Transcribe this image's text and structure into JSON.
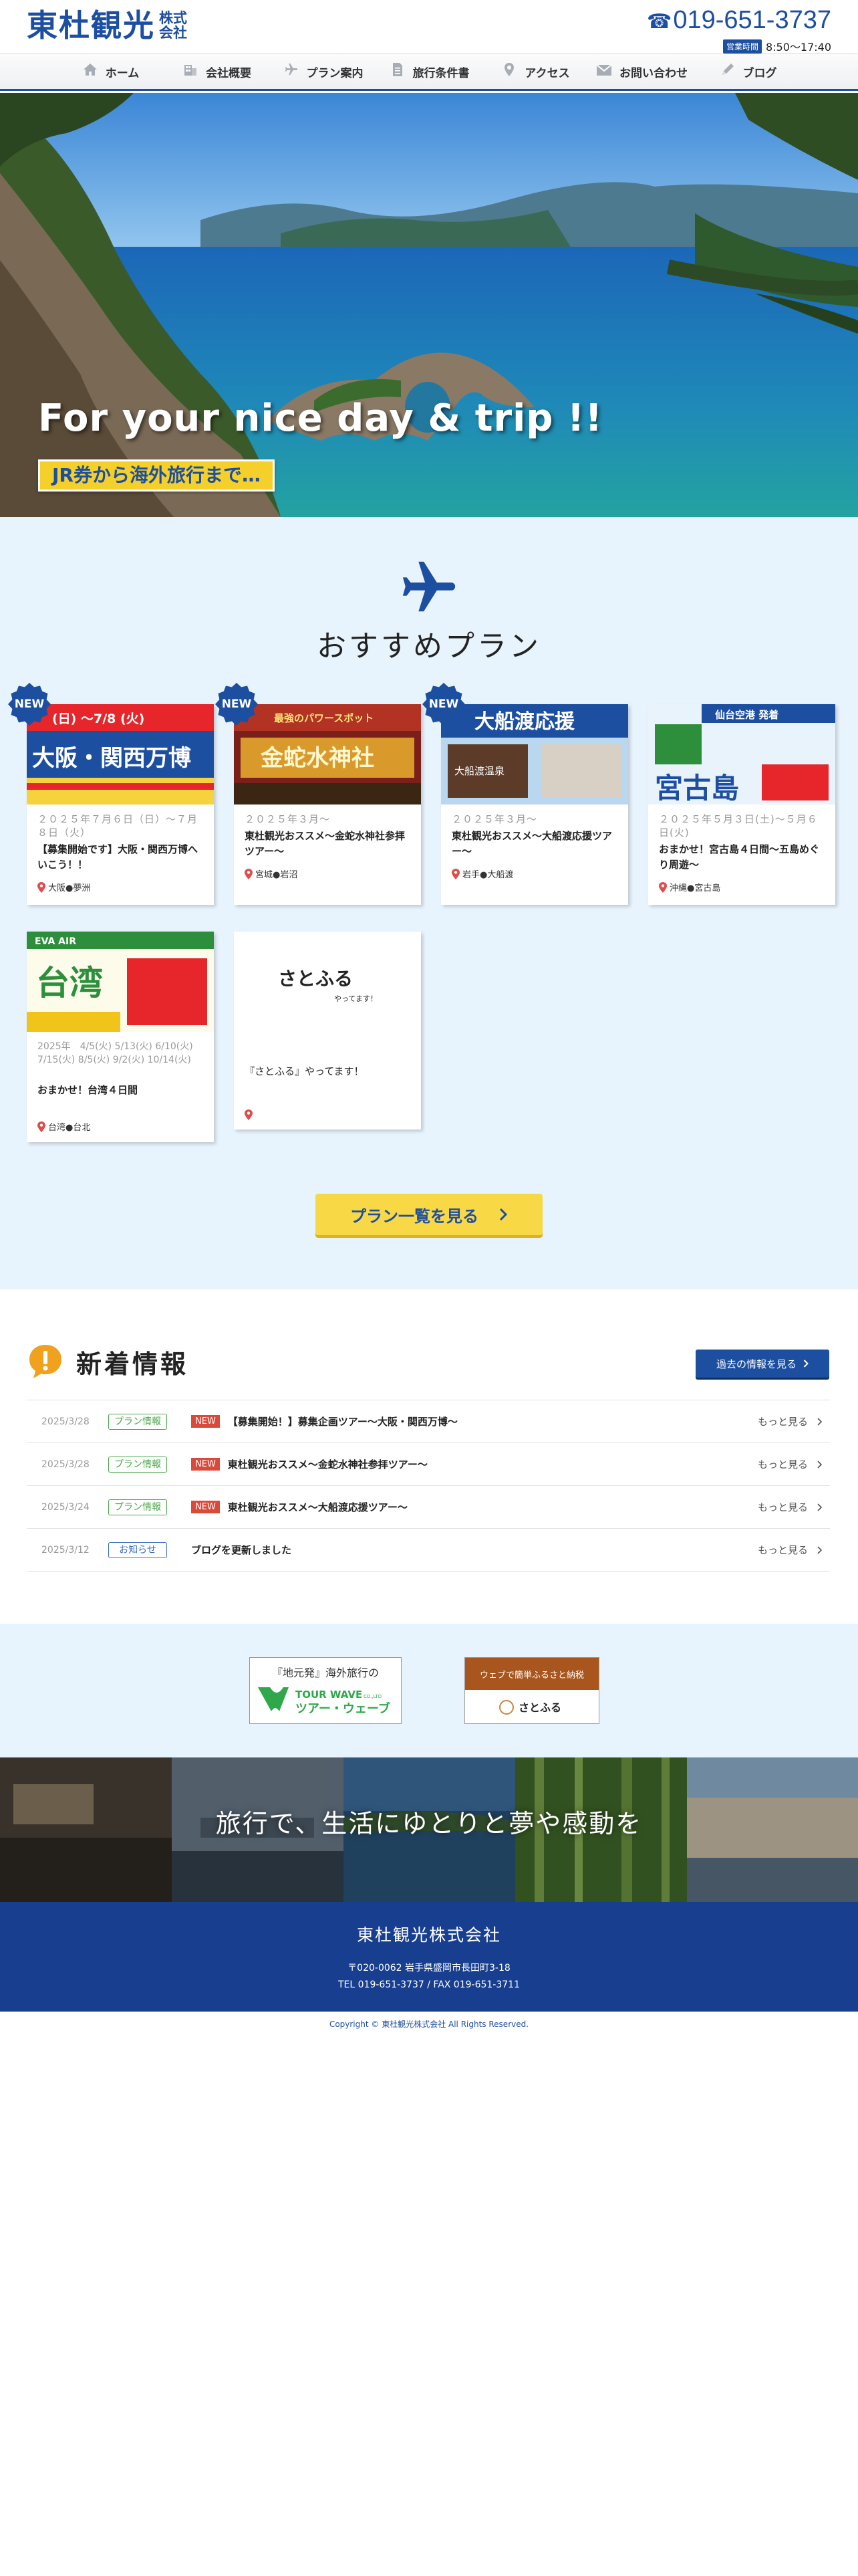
{
  "header": {
    "logo_main": "東杜観光",
    "logo_sub": "株式会社",
    "phone": "019-651-3737",
    "hours_label": "営業時間",
    "hours": "8:50～17:40"
  },
  "nav": [
    {
      "label": "ホーム",
      "icon": "home-icon"
    },
    {
      "label": "会社概要",
      "icon": "building-icon"
    },
    {
      "label": "プラン案内",
      "icon": "plane-icon"
    },
    {
      "label": "旅行条件書",
      "icon": "document-icon"
    },
    {
      "label": "アクセス",
      "icon": "map-pin-icon"
    },
    {
      "label": "お問い合わせ",
      "icon": "mail-icon"
    },
    {
      "label": "ブログ",
      "icon": "pencil-icon"
    }
  ],
  "hero": {
    "title": "For your nice day & trip !!",
    "badge": "JR券から海外旅行まで…"
  },
  "plans": {
    "title": "おすすめプラン",
    "new_label": "NEW",
    "items": [
      {
        "date": "２０２５年７月６日（日）～７月８日（火）",
        "title": "【募集開始です】大阪・関西万博へいこう！！",
        "location": "大阪●夢洲",
        "img_text": "大阪・関西万博",
        "img_sub": "(日) ～7/8 (火)"
      },
      {
        "date": "２０２５年３月～",
        "title": "東杜観光おススメ～金蛇水神社参拝ツアー～",
        "location": "宮城●岩沼",
        "img_text": "金蛇水神社",
        "img_sub": "最強のパワースポット"
      },
      {
        "date": "２０２５年３月～",
        "title": "東杜観光おススメ～大船渡応援ツアー～",
        "location": "岩手●大船渡",
        "img_text": "大船渡応援",
        "img_sub": "大船渡温泉"
      },
      {
        "date": "２０２５年５月３日(土)～５月６日(火)",
        "title": "おまかせ！宮古島４日間～五島めぐり周遊～",
        "location": "沖縄●宮古島",
        "img_text": "宮古島",
        "img_sub": "仙台空港 発着"
      },
      {
        "date": "2025年　4/5(火) 5/13(火) 6/10(火) 7/15(火) 8/5(火) 9/2(火) 10/14(火)",
        "title": "おまかせ！台湾４日間",
        "location": "台湾●台北",
        "img_text": "台湾",
        "img_sub": "EVA AIR"
      },
      {
        "date": "",
        "title": "『さとふる』やってます！",
        "location": "",
        "img_text": "さとふる",
        "img_sub": "やってます！"
      }
    ],
    "more_button": "プラン一覧を見る"
  },
  "news": {
    "title": "新着情報",
    "past_button": "過去の情報を見る",
    "more_label": "もっと見る",
    "new_label": "NEW",
    "items": [
      {
        "date": "2025/3/28",
        "category": "プラン情報",
        "type": "plan",
        "is_new": true,
        "text": "【募集開始！】募集企画ツアー～大阪・関西万博～"
      },
      {
        "date": "2025/3/28",
        "category": "プラン情報",
        "type": "plan",
        "is_new": true,
        "text": "東杜観光おススメ～金蛇水神社参拝ツアー～"
      },
      {
        "date": "2025/3/24",
        "category": "プラン情報",
        "type": "plan",
        "is_new": true,
        "text": "東杜観光おススメ～大船渡応援ツアー～"
      },
      {
        "date": "2025/3/12",
        "category": "お知らせ",
        "type": "notice",
        "is_new": false,
        "text": "ブログを更新しました"
      }
    ]
  },
  "banners": {
    "tourwave_top": "『地元発』海外旅行の",
    "tourwave_en": "TOUR WAVE",
    "tourwave_co": "CO.,LTD",
    "tourwave_jp": "ツアー・ウェーブ",
    "satofuru_top": "ウェブで簡単ふるさと納税",
    "satofuru_name": "さとふる"
  },
  "strip": {
    "text": "旅行で、生活にゆとりと夢や感動を"
  },
  "footer": {
    "company": "東杜観光株式会社",
    "address": "〒020-0062 岩手県盛岡市長田町3-18",
    "tel": "TEL 019-651-3737 / FAX 019-651-3711",
    "copyright": "Copyright © 東杜観光株式会社 All Rights Reserved."
  }
}
